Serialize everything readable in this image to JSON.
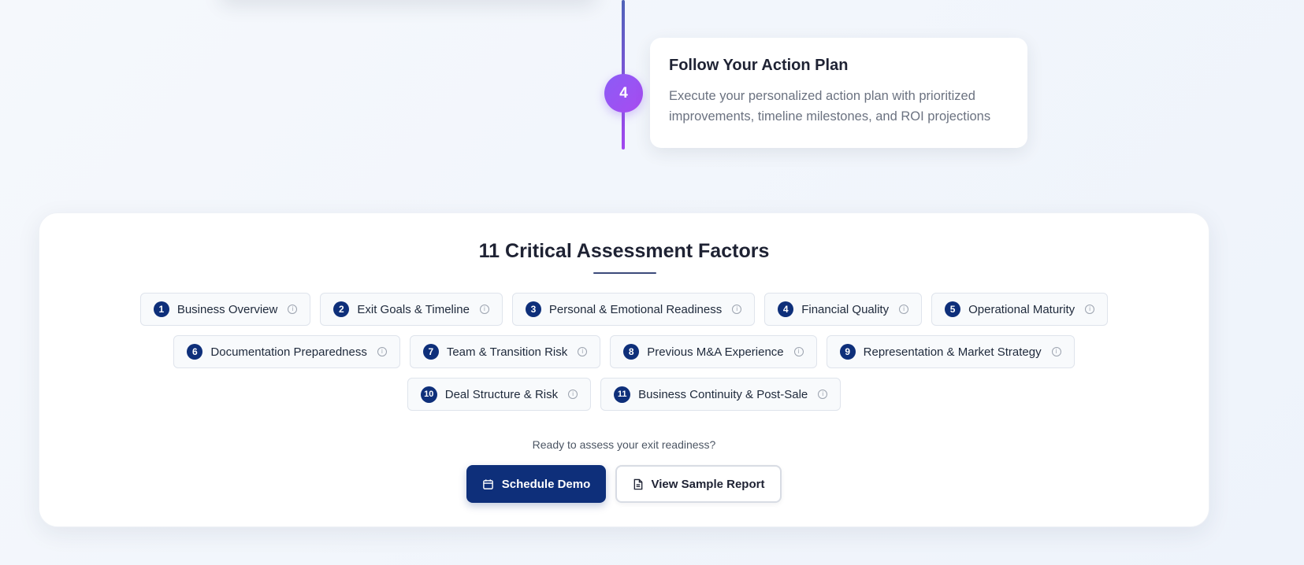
{
  "step": {
    "number": "4",
    "title": "Follow Your Action Plan",
    "description": "Execute your personalized action plan with prioritized improvements, timeline milestones, and ROI projections"
  },
  "factors": {
    "title": "11 Critical Assessment Factors",
    "rows": [
      [
        {
          "num": "1",
          "label": "Business Overview"
        },
        {
          "num": "2",
          "label": "Exit Goals & Timeline"
        },
        {
          "num": "3",
          "label": "Personal & Emotional Readiness"
        },
        {
          "num": "4",
          "label": "Financial Quality"
        },
        {
          "num": "5",
          "label": "Operational Maturity"
        }
      ],
      [
        {
          "num": "6",
          "label": "Documentation Preparedness"
        },
        {
          "num": "7",
          "label": "Team & Transition Risk"
        },
        {
          "num": "8",
          "label": "Previous M&A Experience"
        },
        {
          "num": "9",
          "label": "Representation & Market Strategy"
        }
      ],
      [
        {
          "num": "10",
          "label": "Deal Structure & Risk"
        },
        {
          "num": "11",
          "label": "Business Continuity & Post-Sale"
        }
      ]
    ]
  },
  "cta": {
    "prompt": "Ready to assess your exit readiness?",
    "primary_label": "Schedule Demo",
    "primary_icon": "calendar-icon",
    "secondary_label": "View Sample Report",
    "secondary_icon": "document-icon"
  },
  "colors": {
    "primary": "#0e2f7a",
    "step_accent": "#8b5cf6"
  }
}
